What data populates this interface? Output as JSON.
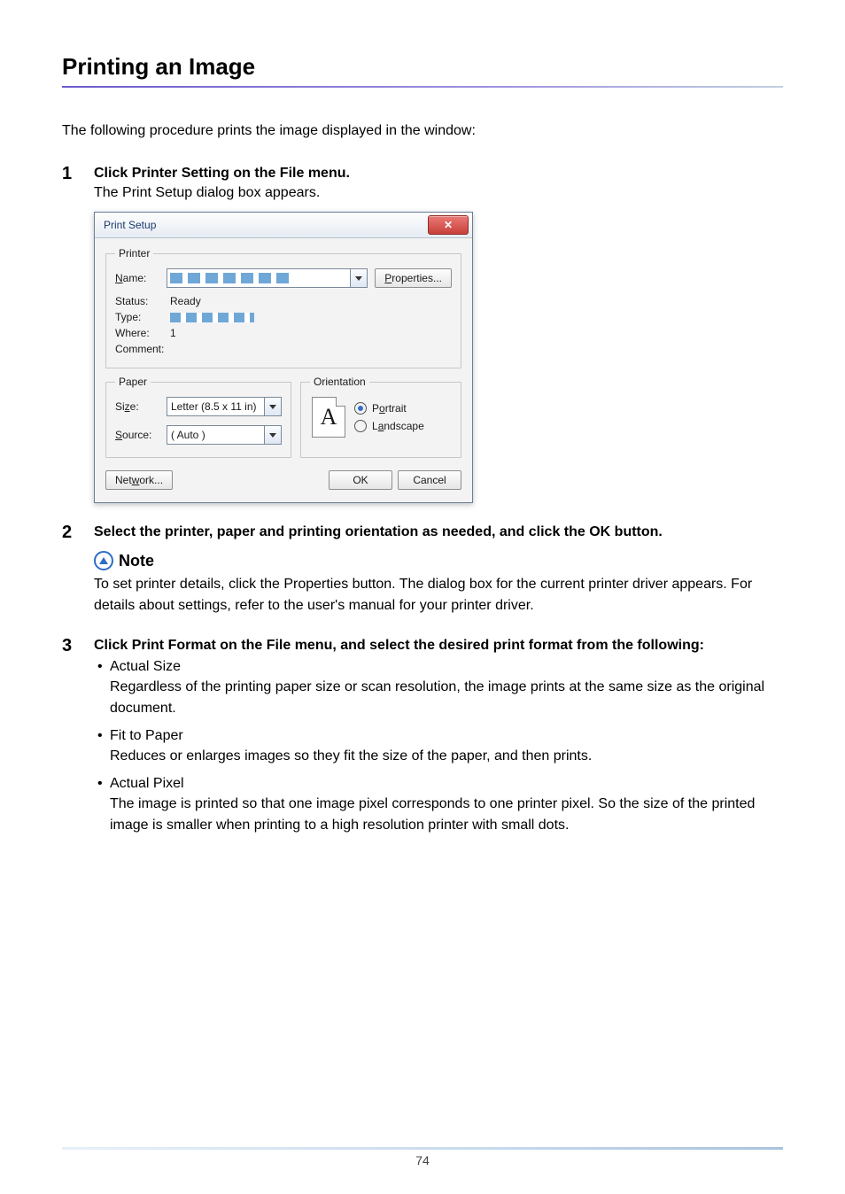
{
  "page": {
    "title": "Printing an Image",
    "intro": "The following procedure prints the image displayed in the window:",
    "page_number": "74"
  },
  "steps": {
    "s1": {
      "num": "1",
      "title": "Click Printer Setting on the File menu.",
      "body": "The Print Setup dialog box appears."
    },
    "s2": {
      "num": "2",
      "title": "Select the printer, paper and printing orientation as needed, and click the OK button."
    },
    "s3": {
      "num": "3",
      "title": "Click Print Format on the File menu, and select the desired print format from the following:"
    }
  },
  "dialog": {
    "title": "Print Setup",
    "printer_legend": "Printer",
    "labels": {
      "name": "Name:",
      "status": "Status:",
      "type": "Type:",
      "where": "Where:",
      "comment": "Comment:",
      "properties": "Properties...",
      "paper": "Paper",
      "size": "Size:",
      "source": "Source:",
      "orientation": "Orientation",
      "portrait": "Portrait",
      "landscape": "Landscape",
      "network": "Network...",
      "ok": "OK",
      "cancel": "Cancel"
    },
    "values": {
      "status": "Ready",
      "where": "1",
      "size": "Letter (8.5 x 11 in)",
      "source": "( Auto )",
      "orientation_icon_text": "A"
    }
  },
  "note": {
    "heading": "Note",
    "text": "To set printer details, click the Properties button. The dialog box for the current printer driver appears. For details about settings, refer to the user's manual for your printer driver."
  },
  "formats": {
    "f1": {
      "title": "Actual Size",
      "desc": "Regardless of the printing paper size or scan resolution, the image prints at the same size as the original document."
    },
    "f2": {
      "title": "Fit to Paper",
      "desc": "Reduces or enlarges images so they fit the size of the paper, and then prints."
    },
    "f3": {
      "title": "Actual Pixel",
      "desc": "The image is printed so that one image pixel corresponds to one printer pixel. So the size of the printed image is smaller when printing to a high resolution printer with small dots."
    }
  }
}
